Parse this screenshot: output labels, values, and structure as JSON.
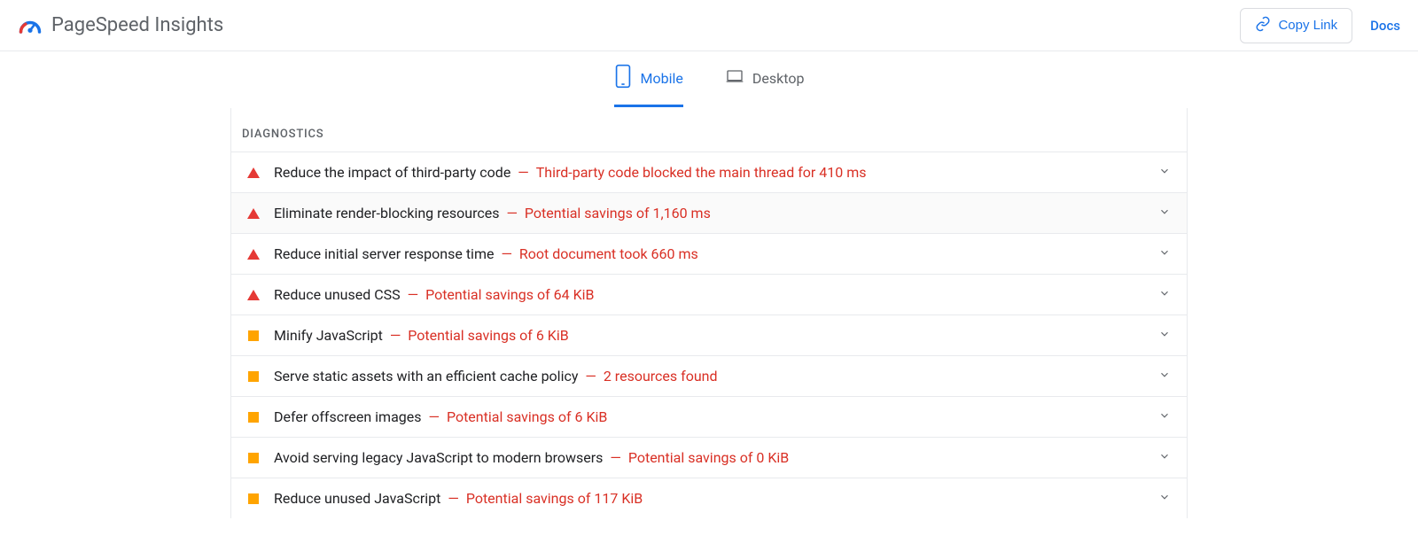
{
  "header": {
    "app_title": "PageSpeed Insights",
    "copy_link_label": "Copy Link",
    "docs_label": "Docs"
  },
  "tabs": {
    "mobile": "Mobile",
    "desktop": "Desktop",
    "active": "mobile"
  },
  "section_title": "DIAGNOSTICS",
  "diagnostics": [
    {
      "severity": "fail",
      "title": "Reduce the impact of third-party code",
      "detail": "Third-party code blocked the main thread for 410 ms"
    },
    {
      "severity": "fail",
      "title": "Eliminate render-blocking resources",
      "detail": "Potential savings of 1,160 ms",
      "highlight": true
    },
    {
      "severity": "fail",
      "title": "Reduce initial server response time",
      "detail": "Root document took 660 ms"
    },
    {
      "severity": "fail",
      "title": "Reduce unused CSS",
      "detail": "Potential savings of 64 KiB"
    },
    {
      "severity": "warn",
      "title": "Minify JavaScript",
      "detail": "Potential savings of 6 KiB"
    },
    {
      "severity": "warn",
      "title": "Serve static assets with an efficient cache policy",
      "detail": "2 resources found"
    },
    {
      "severity": "warn",
      "title": "Defer offscreen images",
      "detail": "Potential savings of 6 KiB"
    },
    {
      "severity": "warn",
      "title": "Avoid serving legacy JavaScript to modern browsers",
      "detail": "Potential savings of 0 KiB"
    },
    {
      "severity": "warn",
      "title": "Reduce unused JavaScript",
      "detail": "Potential savings of 117 KiB"
    }
  ]
}
